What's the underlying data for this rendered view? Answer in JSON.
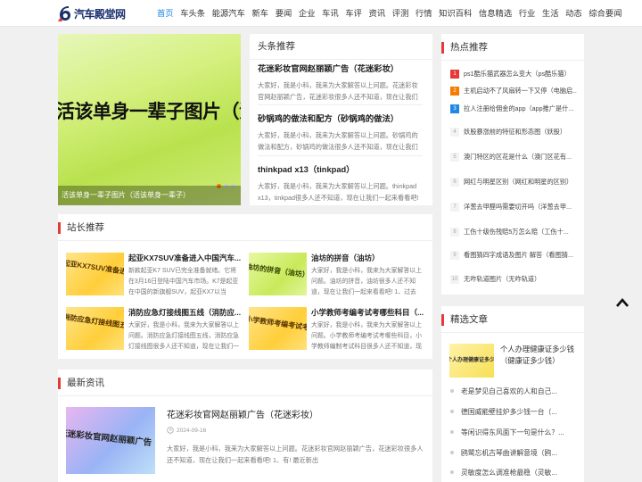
{
  "logo": {
    "text": "汽车殿堂网"
  },
  "nav": {
    "items": [
      "首页",
      "车头条",
      "能源汽车",
      "新车",
      "要闻",
      "企业",
      "车讯",
      "车评",
      "资讯",
      "评测",
      "行情",
      "知识百科",
      "信息精选",
      "行业",
      "生活",
      "动态",
      "综合要闻"
    ],
    "active_index": 0
  },
  "slider": {
    "image_text": "活该单身一辈子图片（活该单身一辈子",
    "caption": "活该单身一辈子图片（活该单身一辈子）"
  },
  "headline": {
    "title": "头条推荐",
    "items": [
      {
        "title": "花迷彩妆官网赵丽颖广告（花迷彩妆）",
        "desc": "大家好，我是小科，我来为大家解答以上问题。花迷彩妆官网赵丽颖广告，花迷彩妆很多人还不知道，现在让我们一起"
      },
      {
        "title": "砂锅鸡的做法和配方（砂锅鸡的做法）",
        "desc": "大家好，我是小科，我来为大家解答以上问题。砂锅鸡的做法和配方，砂锅鸡的做法很多人还不知道，现在让我们一起"
      },
      {
        "title": "thinkpad x13（tinkpad）",
        "desc": "大家好，我是小科，我来为大家解答以上问题。thinkpad x13，tinkpad很多人还不知道，现在让我们一起来看看吧!"
      }
    ]
  },
  "hot": {
    "title": "热点推荐",
    "items": [
      {
        "num": "1",
        "text": "ps1酷乐猫武器怎么变大（ps酷乐猫）"
      },
      {
        "num": "2",
        "text": "主机启动不了风扇转一下又停（电脑启..."
      },
      {
        "num": "3",
        "text": "拉人注册给佣金的app（app推广是什..."
      },
      {
        "num": "4",
        "text": "妖股暴涨前的特征和形态图（妖股）"
      },
      {
        "num": "5",
        "text": "澳门特区的区花是什么（澳门区花有..."
      },
      {
        "num": "6",
        "text": "网红与明星区别（网红和明星的区别）"
      },
      {
        "num": "7",
        "text": "洋葱去甲醛吗需要切开吗（洋葱去甲..."
      },
      {
        "num": "8",
        "text": "工伤十级伤残赔5万怎么赔（工伤十..."
      },
      {
        "num": "9",
        "text": "看图猜四字成语及图片 解答（看图猜..."
      },
      {
        "num": "10",
        "text": "无咋轨道图片（无咋轨道）"
      }
    ]
  },
  "station": {
    "title": "站长推荐",
    "items": [
      {
        "thumb": "起亚KX7SUV准备进入中国汽车市场",
        "title": "起亚KX7SUV准备进入中国汽车...",
        "desc": "新款起亚K7 SUV已完全准备就绪。它将在3月16日登陆中国汽车市场。K7是起亚在中国的新旗舰SUV，起亚KX7以当"
      },
      {
        "thumb": "油坊的拼音（油坊）",
        "title": "油坊的拼音（油坊）",
        "desc": "大家好，我是小科，我来为大家解答以上问题。油坊的拼音，油坊很多人还不知道，现在让我们一起来看看吧! 1、过去"
      },
      {
        "thumb": "消防应急灯接线图五线（消防应急灯）",
        "title": "消防应急灯接线图五线（消防应...",
        "desc": "大家好，我是小科，我来为大家解答以上问题。消防应急灯接线图五线，消防应急灯接线图很多人还不知道，现在让我们一"
      },
      {
        "thumb": "小学教师考编考试考哪些科目",
        "title": "小学教师考编考试考哪些科目（...",
        "desc": "大家好，我是小科，我来为大家解答以上问题。小学教师考编考试考哪些科目，小学教师编制考试科目很多人还不知道，现在"
      }
    ]
  },
  "latest": {
    "title": "最新资讯",
    "item": {
      "thumb": "花迷彩妆官网赵丽颖广告（花迷",
      "title": "花迷彩妆官网赵丽颖广告（花迷彩妆）",
      "date": "2024-09-16",
      "desc": "大家好，我是小科，我来为大家解答以上问题。花迷彩妆官网赵丽颖广告，花迷彩妆很多人还不知道，现在让我们一起来看看吧! 1、有! 最近新出"
    }
  },
  "selected": {
    "title": "精选文章",
    "top": {
      "thumb": "个人办理健康证多少钱",
      "title": "个人办理健康证多少钱（健康证多少钱）"
    },
    "items": [
      "老是梦见自己喜欢的人和自己...",
      "德国威能壁挂炉多少钱一台（...",
      "等闲识得东风面下一句是什么？...",
      "鸥鹭忘机古琴曲讲解意境（鸥...",
      "灵敏度怎么调准枪最稳（灵敏..."
    ]
  },
  "colors": {
    "accent": "#1e88e5",
    "red": "#e53935",
    "orange": "#f57c00"
  }
}
